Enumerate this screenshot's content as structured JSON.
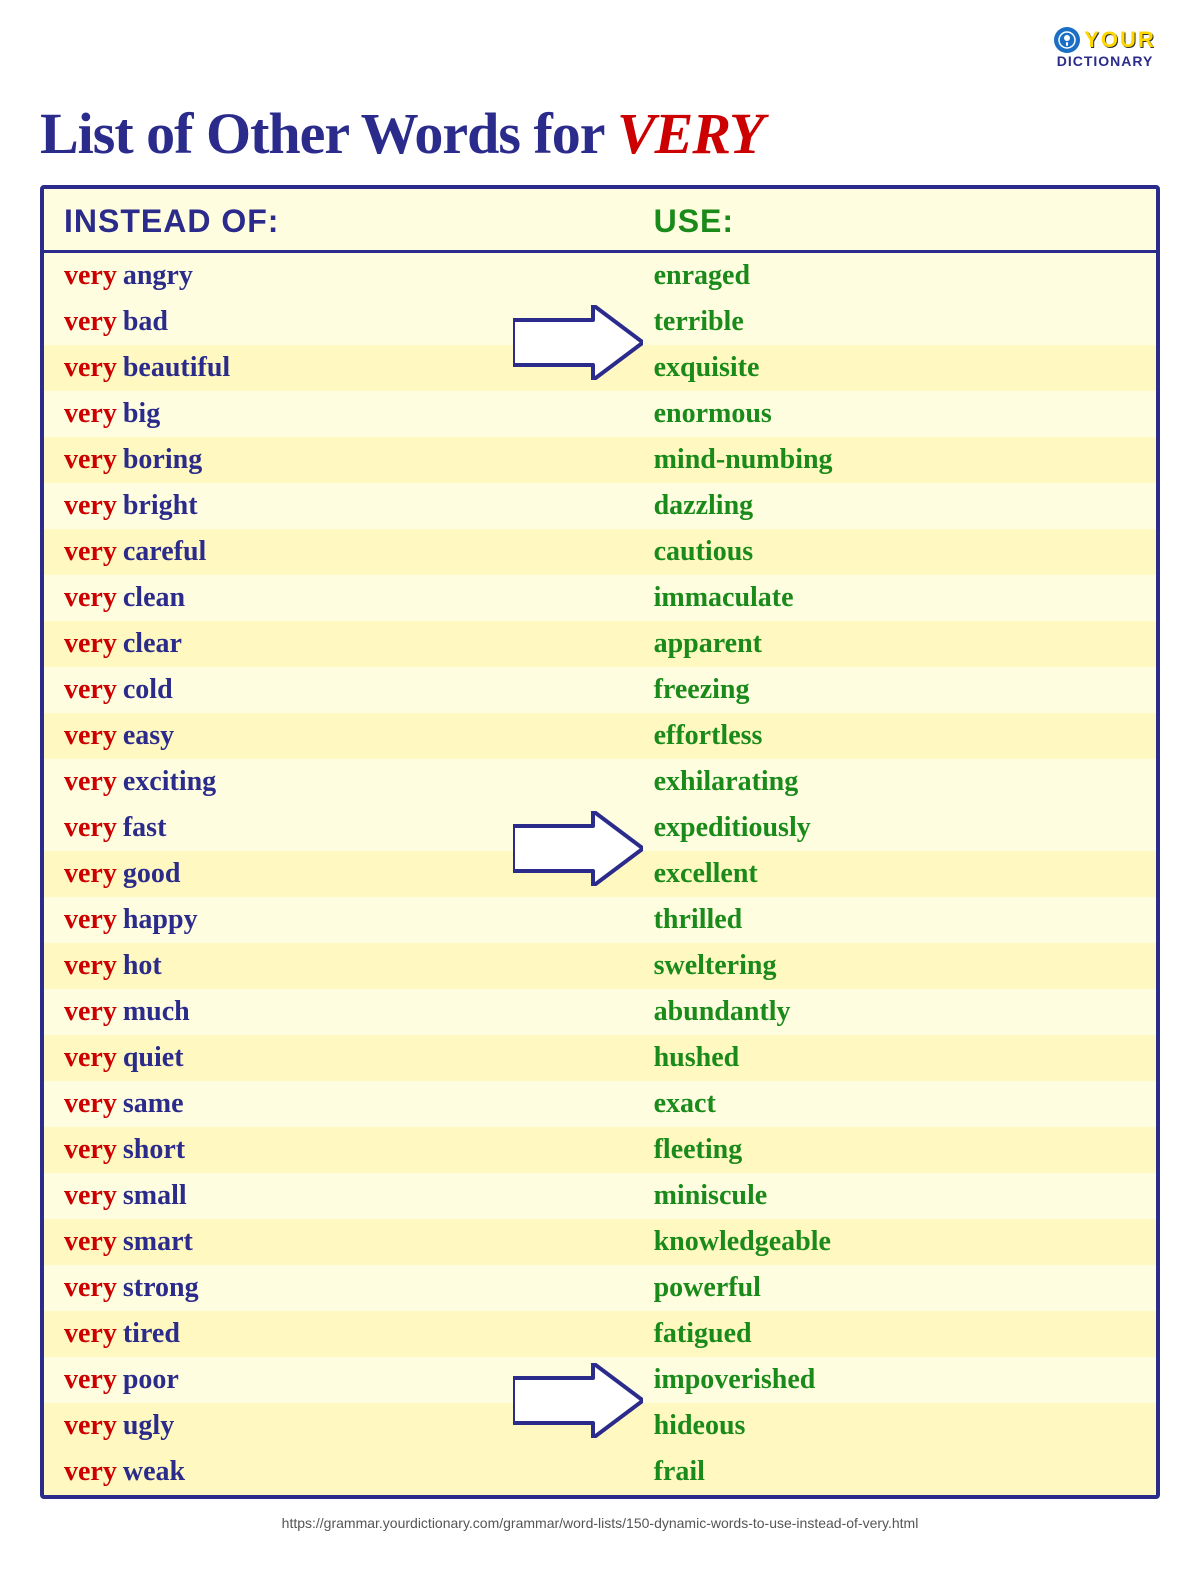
{
  "logo": {
    "your": "YOUR",
    "dictionary": "DICTIONARY"
  },
  "title": {
    "prefix": "List of Other Words for ",
    "highlight": "VERY"
  },
  "header": {
    "instead": "INSTEAD OF:",
    "use": "USE:"
  },
  "rows": [
    {
      "very": "very",
      "word": "angry",
      "synonym": "enraged",
      "arrow": false
    },
    {
      "very": "very",
      "word": "bad",
      "synonym": "terrible",
      "arrow": true
    },
    {
      "very": "very",
      "word": "beautiful",
      "synonym": "exquisite",
      "arrow": false
    },
    {
      "very": "very",
      "word": "big",
      "synonym": "enormous",
      "arrow": false
    },
    {
      "very": "very",
      "word": "boring",
      "synonym": "mind-numbing",
      "arrow": false
    },
    {
      "very": "very",
      "word": "bright",
      "synonym": "dazzling",
      "arrow": false
    },
    {
      "very": "very",
      "word": "careful",
      "synonym": "cautious",
      "arrow": false
    },
    {
      "very": "very",
      "word": "clean",
      "synonym": "immaculate",
      "arrow": false
    },
    {
      "very": "very",
      "word": "clear",
      "synonym": "apparent",
      "arrow": false
    },
    {
      "very": "very",
      "word": "cold",
      "synonym": "freezing",
      "arrow": false
    },
    {
      "very": "very",
      "word": "easy",
      "synonym": "effortless",
      "arrow": false
    },
    {
      "very": "very",
      "word": "exciting",
      "synonym": "exhilarating",
      "arrow": false
    },
    {
      "very": "very",
      "word": "fast",
      "synonym": "expeditiously",
      "arrow": true
    },
    {
      "very": "very",
      "word": "good",
      "synonym": "excellent",
      "arrow": false
    },
    {
      "very": "very",
      "word": "happy",
      "synonym": "thrilled",
      "arrow": false
    },
    {
      "very": "very",
      "word": "hot",
      "synonym": "sweltering",
      "arrow": false
    },
    {
      "very": "very",
      "word": "much",
      "synonym": "abundantly",
      "arrow": false
    },
    {
      "very": "very",
      "word": "quiet",
      "synonym": "hushed",
      "arrow": false
    },
    {
      "very": "very",
      "word": "same",
      "synonym": "exact",
      "arrow": false
    },
    {
      "very": "very",
      "word": "short",
      "synonym": "fleeting",
      "arrow": false
    },
    {
      "very": "very",
      "word": "small",
      "synonym": "miniscule",
      "arrow": false
    },
    {
      "very": "very",
      "word": "smart",
      "synonym": "knowledgeable",
      "arrow": false
    },
    {
      "very": "very",
      "word": "strong",
      "synonym": "powerful",
      "arrow": false
    },
    {
      "very": "very",
      "word": "tired",
      "synonym": "fatigued",
      "arrow": false
    },
    {
      "very": "very",
      "word": "poor",
      "synonym": "impoverished",
      "arrow": true
    },
    {
      "very": "very",
      "word": "ugly",
      "synonym": "hideous",
      "arrow": false
    },
    {
      "very": "very",
      "word": "weak",
      "synonym": "frail",
      "arrow": false
    }
  ],
  "footer": {
    "url": "https://grammar.yourdictionary.com/grammar/word-lists/150-dynamic-words-to-use-instead-of-very.html"
  }
}
